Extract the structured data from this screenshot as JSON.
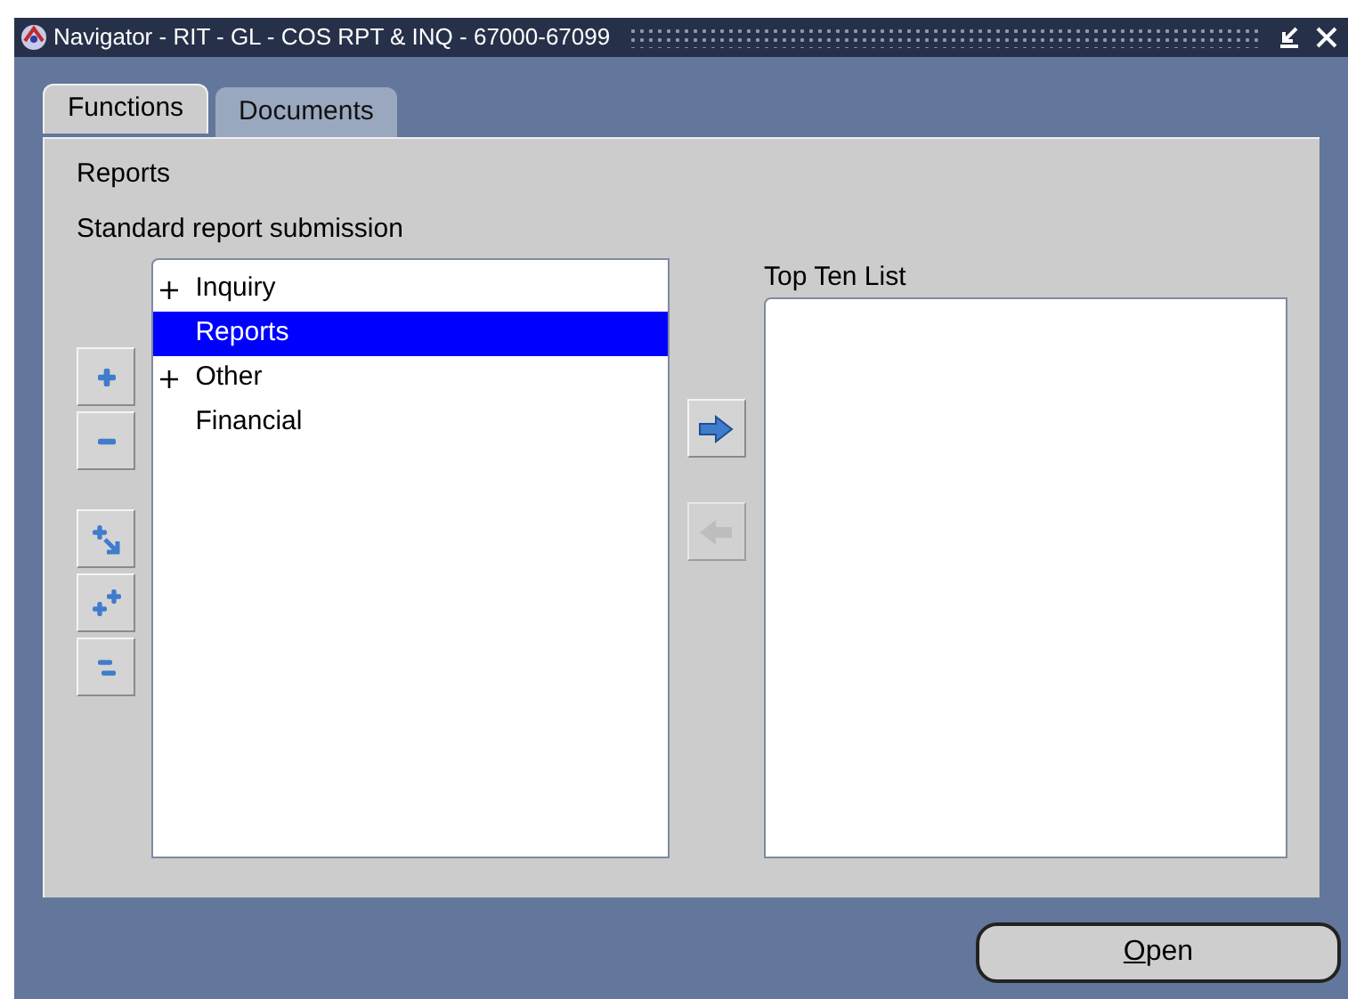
{
  "window": {
    "title": "Navigator - RIT - GL - COS RPT & INQ - 67000-67099"
  },
  "tabs": [
    {
      "label": "Functions",
      "selected": true
    },
    {
      "label": "Documents",
      "selected": false
    }
  ],
  "header": {
    "title": "Reports",
    "subtitle": "Standard report submission"
  },
  "tree_buttons": [
    {
      "kind": "expand"
    },
    {
      "kind": "collapse"
    },
    {
      "kind": "expand-branch"
    },
    {
      "kind": "expand-all"
    },
    {
      "kind": "collapse-all"
    }
  ],
  "tree": [
    {
      "label": "Inquiry",
      "collapsed": true,
      "selected": false
    },
    {
      "label": "Reports",
      "collapsed": false,
      "selected": true
    },
    {
      "label": "Other",
      "collapsed": true,
      "selected": false
    },
    {
      "label": "Financial",
      "collapsed": false,
      "selected": false
    }
  ],
  "move_buttons": [
    {
      "kind": "add",
      "disabled": false
    },
    {
      "kind": "remove",
      "disabled": true
    }
  ],
  "top_ten": {
    "label": "Top Ten List"
  },
  "open_button": {
    "mnemonic": "O",
    "rest": "pen"
  }
}
